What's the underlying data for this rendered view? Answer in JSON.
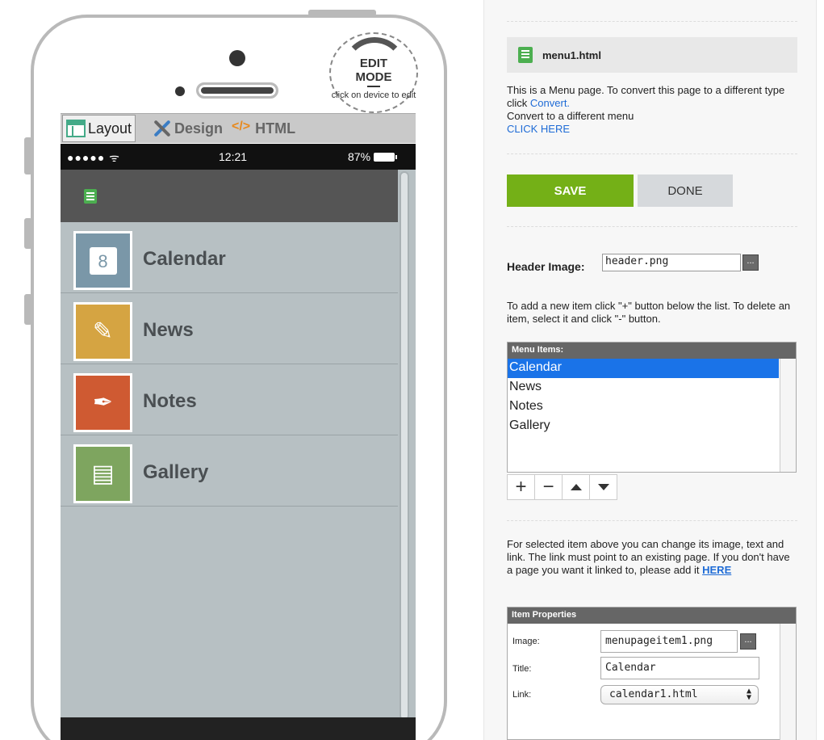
{
  "edit_badge": {
    "title_line1": "EDIT",
    "title_line2": "MODE",
    "hint": "click on device to edit"
  },
  "tabs": [
    {
      "label": "Layout",
      "icon": "layout-icon",
      "active": true
    },
    {
      "label": "Design",
      "icon": "design-icon",
      "active": false
    },
    {
      "label": "HTML",
      "icon": "code-icon",
      "html_glyph": "</>",
      "active": false
    }
  ],
  "status_bar": {
    "signal": "●●●●● ᯤ",
    "time": "12:21",
    "battery": "87%"
  },
  "menu_items": [
    {
      "label": "Calendar",
      "icon": "calendar-icon",
      "glyph": "8",
      "color": "#7a97a8"
    },
    {
      "label": "News",
      "icon": "news-icon",
      "glyph": "✎",
      "color": "#d5a442"
    },
    {
      "label": "Notes",
      "icon": "pen-icon",
      "glyph": "✒",
      "color": "#cf5a32"
    },
    {
      "label": "Gallery",
      "icon": "gallery-icon",
      "glyph": "▤",
      "color": "#7ea55f"
    }
  ],
  "panel": {
    "file_name": "menu1.html",
    "description": "This is a Menu page. To convert this page to a different type click",
    "convert_link": "Convert.",
    "convert_menu_text": "Convert to a different menu",
    "click_here_link": "CLICK HERE",
    "save_label": "SAVE",
    "done_label": "DONE",
    "header_image_label": "Header Image:",
    "header_image_value": "header.png",
    "browse_label": "...",
    "add_hint": "To add a new item click \"+\" button below the list. To delete an item, select it and click \"-\" button.",
    "menu_items_header": "Menu Items:",
    "list_items": [
      "Calendar",
      "News",
      "Notes",
      "Gallery"
    ],
    "selected_item": "Calendar",
    "tool_add": "+",
    "tool_remove": "−",
    "selected_hint": "For selected item above you can change its image, text and link. The link must point to an existing page. If you don't have a page you want it linked to, please add it",
    "here_link": "HERE",
    "item_properties_header": "Item Properties",
    "image_label": "Image:",
    "image_value": "menupageitem1.png",
    "title_label": "Title:",
    "title_value": "Calendar",
    "link_label": "Link:",
    "link_value": "calendar1.html"
  },
  "colors": {
    "save": "#74b017",
    "selection": "#1a73e8",
    "link": "#1e6bd6"
  }
}
